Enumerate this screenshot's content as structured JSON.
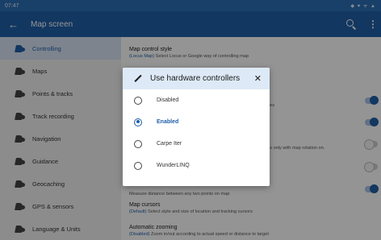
{
  "status_bar": {
    "time": "07:47",
    "icons": "◆ ♥ ᯤ ▲"
  },
  "app_bar": {
    "title": "Map screen",
    "back_glyph": "←",
    "more_glyph": "⋮"
  },
  "sidebar": {
    "items": [
      {
        "label": "Controlling",
        "active": true
      },
      {
        "label": "Maps"
      },
      {
        "label": "Points & tracks"
      },
      {
        "label": "Track recording"
      },
      {
        "label": "Navigation"
      },
      {
        "label": "Guidance"
      },
      {
        "label": "Geocaching"
      },
      {
        "label": "GPS & sensors"
      },
      {
        "label": "Language & Units"
      }
    ]
  },
  "settings": {
    "map_control_style": {
      "title": "Map control style",
      "value": "(Locus Map)",
      "desc": " Select Locus or Google way of controlling map"
    },
    "gestures_fragment": "gges",
    "rotation_fragment": "ons only with map rotation on.",
    "measure_desc": "Measure distance between any two points on map",
    "map_cursors": {
      "title": "Map cursors",
      "value": "(Default)",
      "desc": " Select style and size of location and tracking cursors"
    },
    "auto_zoom": {
      "title": "Automatic zooming",
      "value": "(Disabled)",
      "desc": " Zoom in/out according to actual speed or distance to target"
    }
  },
  "toggle_states": [
    true,
    true,
    false,
    false,
    true
  ],
  "dialog": {
    "title": "Use hardware controllers",
    "close_glyph": "✕",
    "options": [
      {
        "label": "Disabled",
        "selected": false
      },
      {
        "label": "Enabled",
        "selected": true
      },
      {
        "label": "Carpe Iter",
        "selected": false
      },
      {
        "label": "WunderLINQ",
        "selected": false
      }
    ]
  },
  "colors": {
    "primary": "#1f5fa8",
    "status_bar": "#2c6fb6",
    "dialog_header": "#dde9f6",
    "sidebar_active": "#d8e4f3"
  }
}
